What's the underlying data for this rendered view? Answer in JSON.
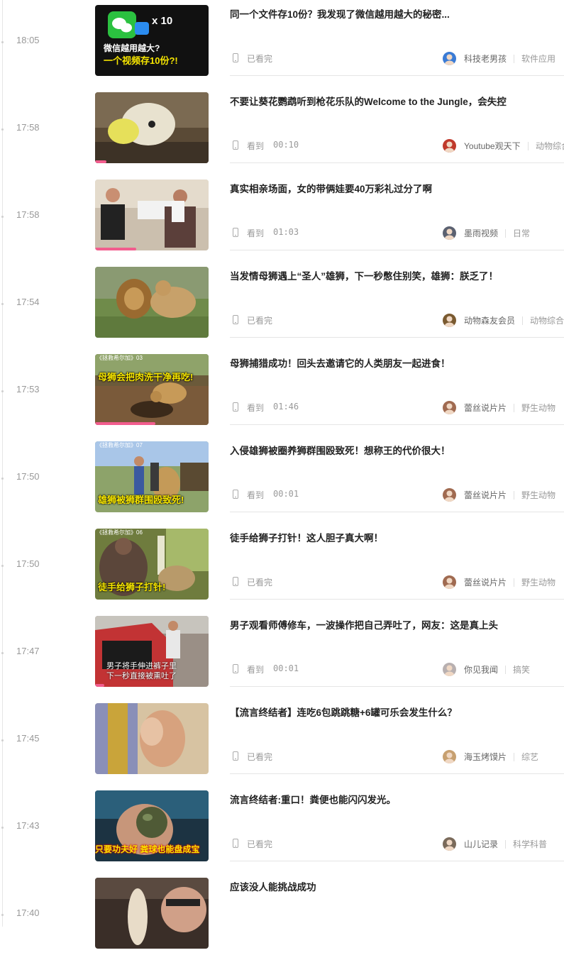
{
  "history": [
    {
      "time": "18:05",
      "title": "同一个文件存10份？我发现了微信越用越大的秘密...",
      "watch_label": "已看完",
      "watch_time": "",
      "author": "科技老男孩",
      "category": "软件应用",
      "progress": 0,
      "thumb_lines": [
        "微信越用越大?",
        "一个视频存10份?!"
      ],
      "thumb_badge": "x 10"
    },
    {
      "time": "17:58",
      "title": "不要让葵花鹦鹉听到枪花乐队的Welcome to the Jungle，会失控",
      "watch_label": "看到",
      "watch_time": "00:10",
      "author": "Youtube观天下",
      "category": "动物综合",
      "progress": 0.1,
      "thumb_lines": []
    },
    {
      "time": "17:58",
      "title": "真实相亲场面，女的带俩娃要40万彩礼过分了啊",
      "watch_label": "看到",
      "watch_time": "01:03",
      "author": "墨雨视频",
      "category": "日常",
      "progress": 0.36,
      "thumb_lines": []
    },
    {
      "time": "17:54",
      "title": "当发情母狮遇上“圣人”雄狮，下一秒憋住别笑，雄狮：朕乏了！",
      "watch_label": "已看完",
      "watch_time": "",
      "author": "动物森友会员",
      "category": "动物综合",
      "progress": 0,
      "thumb_lines": []
    },
    {
      "time": "17:53",
      "title": "母狮捕猎成功！回头去邀请它的人类朋友一起进食！",
      "watch_label": "看到",
      "watch_time": "01:46",
      "author": "蕾丝说片片",
      "category": "野生动物",
      "progress": 0.53,
      "thumb_lines": [
        "母狮会把肉洗干净再吃!"
      ],
      "thumb_corner": "《拯救希尔加》03"
    },
    {
      "time": "17:50",
      "title": "入侵雄狮被圈养狮群围殴致死！想称王的代价很大！",
      "watch_label": "看到",
      "watch_time": "00:01",
      "author": "蕾丝说片片",
      "category": "野生动物",
      "progress": 0,
      "thumb_lines": [
        "雄狮被狮群围殴致死!"
      ],
      "thumb_corner": "《拯救希尔加》07"
    },
    {
      "time": "17:50",
      "title": "徒手给狮子打针！这人胆子真大啊！",
      "watch_label": "已看完",
      "watch_time": "",
      "author": "蕾丝说片片",
      "category": "野生动物",
      "progress": 0,
      "thumb_lines": [
        "徒手给狮子打针!"
      ],
      "thumb_corner": "《拯救希尔加》06"
    },
    {
      "time": "17:47",
      "title": "男子观看师傅修车，一波操作把自己弄吐了，网友：这是真上头",
      "watch_label": "看到",
      "watch_time": "00:01",
      "author": "你见我闻",
      "category": "搞笑",
      "progress": 0.08,
      "thumb_lines": [
        "男子将手伸进裤子里",
        "下一秒直接被熏吐了"
      ]
    },
    {
      "time": "17:45",
      "title": "【流言终结者】连吃6包跳跳糖+6罐可乐会发生什么？",
      "watch_label": "已看完",
      "watch_time": "",
      "author": "海玉烤馍片",
      "category": "综艺",
      "progress": 0,
      "thumb_lines": []
    },
    {
      "time": "17:43",
      "title": "流言终结者:重口！粪便也能闪闪发光。",
      "watch_label": "已看完",
      "watch_time": "",
      "author": "山儿记录",
      "category": "科学科普",
      "progress": 0,
      "thumb_lines": [
        "只要功夫好 粪球也能盘成宝"
      ]
    },
    {
      "time": "17:40",
      "title": "应该没人能挑战成功",
      "watch_label": "",
      "watch_time": "",
      "author": "",
      "category": "",
      "progress": 0,
      "thumb_lines": []
    }
  ],
  "colors": {
    "progress": "#f25d8e",
    "title": "#222222",
    "muted": "#999999",
    "thumb_yellow": "#f7e600"
  },
  "icons": {
    "device": "phone-icon"
  }
}
